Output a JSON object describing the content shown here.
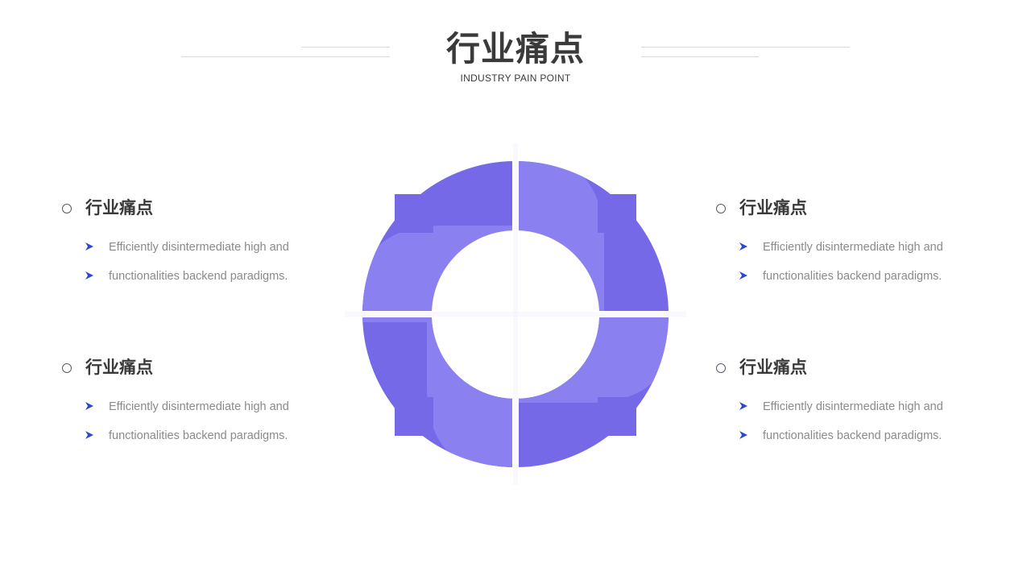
{
  "header": {
    "title": "行业痛点",
    "subtitle": "INDUSTRY PAIN POINT"
  },
  "colors": {
    "primary": "#7569E8",
    "light": "#8A80F0",
    "arrow": "#2B45D4",
    "title": "#3A3A3A",
    "body": "#8A8A8A"
  },
  "blocks": [
    {
      "title": "行业痛点",
      "bullets": [
        "Efficiently disintermediate high and",
        "functionalities backend paradigms."
      ]
    },
    {
      "title": "行业痛点",
      "bullets": [
        "Efficiently disintermediate high and",
        "functionalities backend paradigms."
      ]
    },
    {
      "title": "行业痛点",
      "bullets": [
        "Efficiently disintermediate high and",
        "functionalities backend paradigms."
      ]
    },
    {
      "title": "行业痛点",
      "bullets": [
        "Efficiently disintermediate high and",
        "functionalities backend paradigms."
      ]
    }
  ]
}
